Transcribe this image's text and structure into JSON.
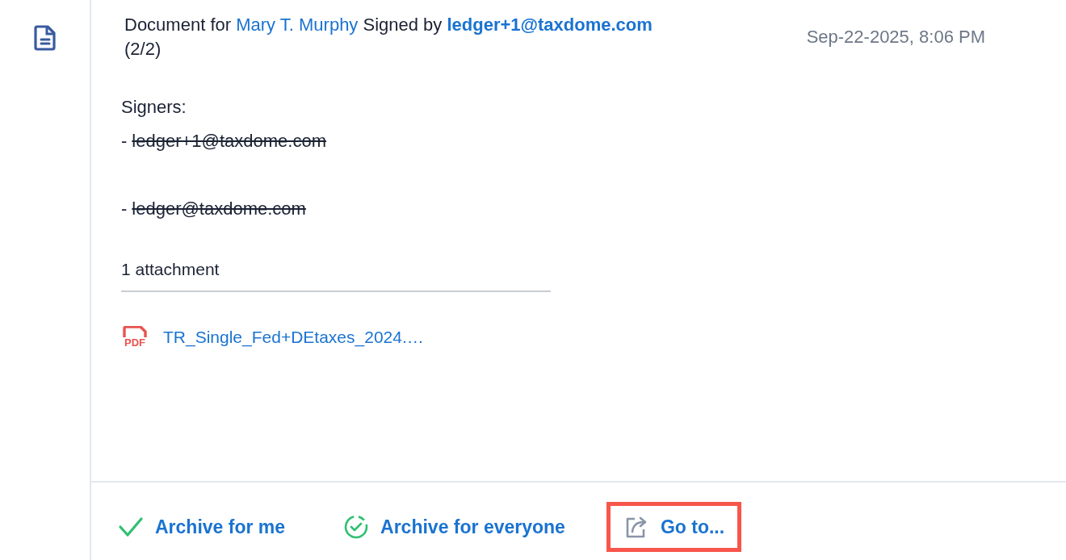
{
  "entry": {
    "kind": "document",
    "prefix": "Document for",
    "client": "Mary T. Murphy",
    "signed_label": "Signed by",
    "signer": "ledger+1@taxdome.com",
    "count": "(2/2)",
    "timestamp": "Sep-22-2025, 8:06 PM"
  },
  "signers": {
    "title": "Signers:",
    "items": [
      {
        "bullet": "-",
        "email": "ledger+1@taxdome.com",
        "struck": true
      },
      {
        "bullet": "-",
        "email": "ledger@taxdome.com",
        "struck": true
      }
    ]
  },
  "attachments": {
    "label": "1 attachment",
    "files": [
      {
        "kind": "pdf",
        "badge": "PDF",
        "name": "TR_Single_Fed+DEtaxes_2024.…"
      }
    ]
  },
  "actions": [
    {
      "kind": "check",
      "label": "Archive for me",
      "highlighted": false
    },
    {
      "kind": "check-circle",
      "label": "Archive for everyone",
      "highlighted": false
    },
    {
      "kind": "goto",
      "label": "Go to...",
      "highlighted": true
    }
  ]
}
